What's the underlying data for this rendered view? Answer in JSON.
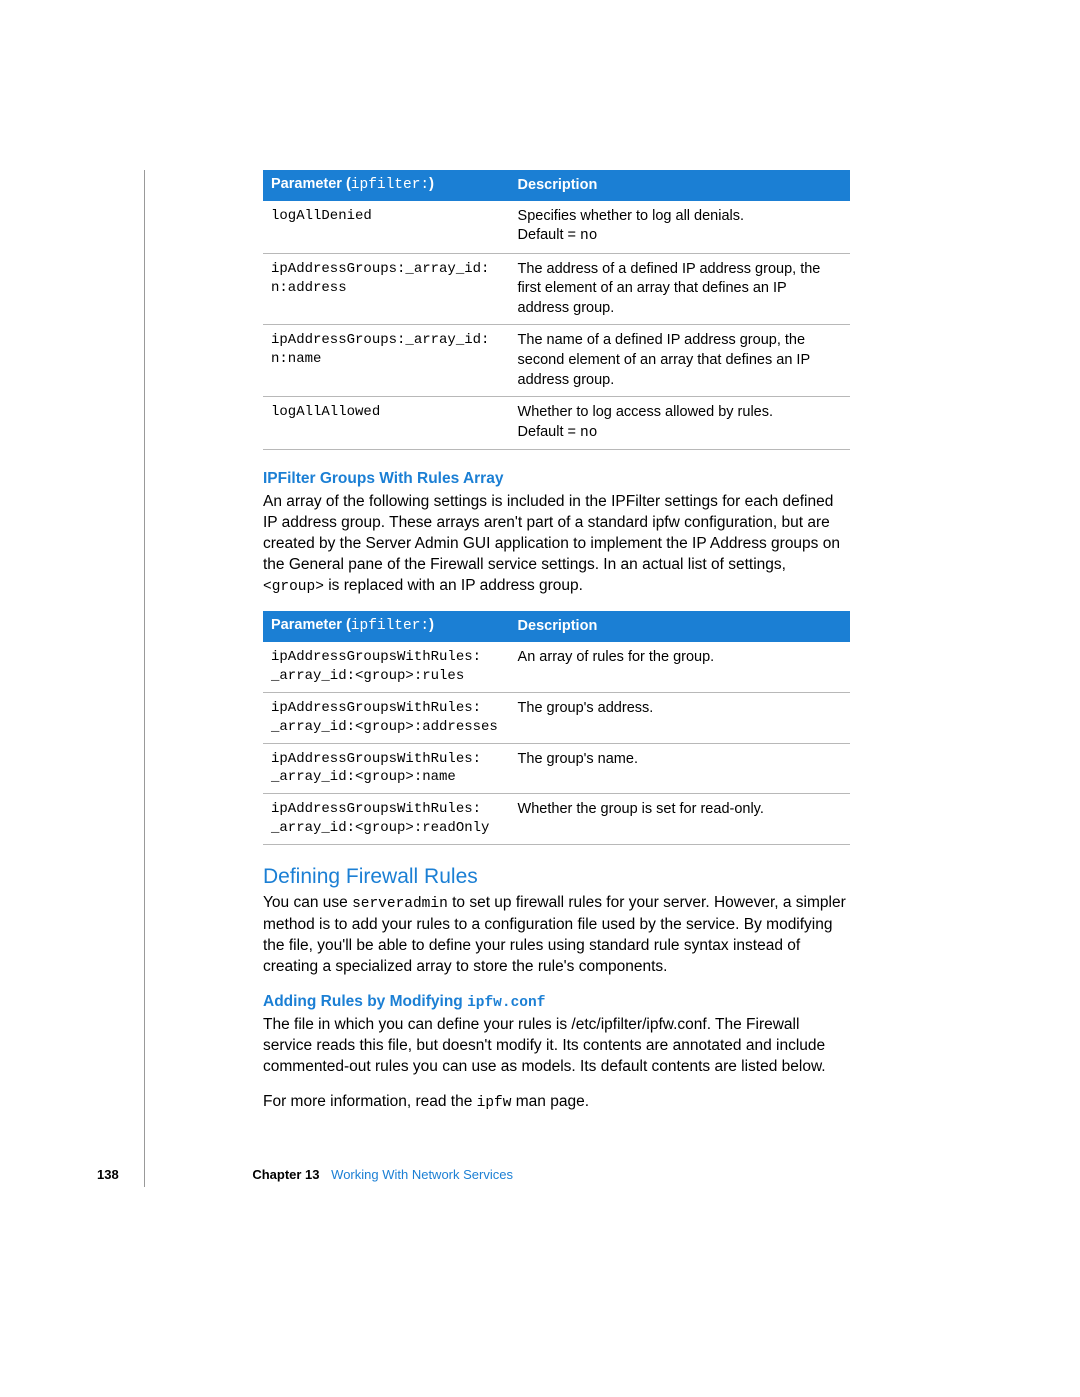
{
  "table1": {
    "header": {
      "param_label": "Parameter (",
      "param_suffix": "ipfilter:",
      "param_close": ")",
      "desc": "Description"
    },
    "rows": [
      {
        "param": "logAllDenied",
        "desc_a": "Specifies whether to log all denials.",
        "desc_b_prefix": "Default = ",
        "desc_b_code": "no"
      },
      {
        "param_line1": "ipAddressGroups:_array_id:",
        "param_line2": "n:address",
        "desc_a": "The address of a defined IP address group, the first element of an array that defines an IP address group."
      },
      {
        "param_line1": "ipAddressGroups:_array_id:",
        "param_line2": "n:name",
        "desc_a": "The name of a defined IP address group, the second element of an array that defines an IP address group."
      },
      {
        "param": "logAllAllowed",
        "desc_a": "Whether to log access allowed by rules.",
        "desc_b_prefix": "Default = ",
        "desc_b_code": "no"
      }
    ]
  },
  "section1": {
    "heading": "IPFilter Groups With Rules Array",
    "para_a": "An array of the following settings is included in the IPFilter settings for each defined IP address group. These arrays aren't part of a standard ipfw configuration, but are created by the Server Admin GUI application to implement the IP Address groups on the General pane of the Firewall service settings. In an actual list of settings, ",
    "para_code": "<group>",
    "para_b": " is replaced with an IP address group."
  },
  "table2": {
    "header": {
      "param_label": "Parameter (",
      "param_suffix": "ipfilter:",
      "param_close": ")",
      "desc": "Description"
    },
    "rows": [
      {
        "param_line1": "ipAddressGroupsWithRules:",
        "param_line2": "_array_id:<group>:rules",
        "desc": "An array of rules for the group."
      },
      {
        "param_line1": "ipAddressGroupsWithRules:",
        "param_line2": "_array_id:<group>:addresses",
        "desc": "The group's address."
      },
      {
        "param_line1": "ipAddressGroupsWithRules:",
        "param_line2": "_array_id:<group>:name",
        "desc": "The group's name."
      },
      {
        "param_line1": "ipAddressGroupsWithRules:",
        "param_line2": "_array_id:<group>:readOnly",
        "desc": "Whether the group is set for read-only."
      }
    ]
  },
  "section2": {
    "heading": "Defining Firewall Rules",
    "para_a": "You can use ",
    "para_code": "serveradmin",
    "para_b": " to set up firewall rules for your server. However, a simpler method is to add your rules to a configuration file used by the service. By modifying the file, you'll be able to define your rules using standard rule syntax instead of creating a specialized array to store the rule's components."
  },
  "section3": {
    "heading_a": "Adding Rules by Modifying ",
    "heading_code": "ipfw.conf",
    "para": "The file in which you can define your rules is /etc/ipfilter/ipfw.conf. The Firewall service reads this file, but doesn't modify it. Its contents are annotated and include commented-out rules you can use as models. Its default contents are listed below."
  },
  "section4": {
    "para_a": "For more information, read the ",
    "para_code": "ipfw",
    "para_b": " man page."
  },
  "footer": {
    "pageno": "138",
    "chapter_label": "Chapter 13",
    "chapter_name": "Working With Network Services"
  }
}
